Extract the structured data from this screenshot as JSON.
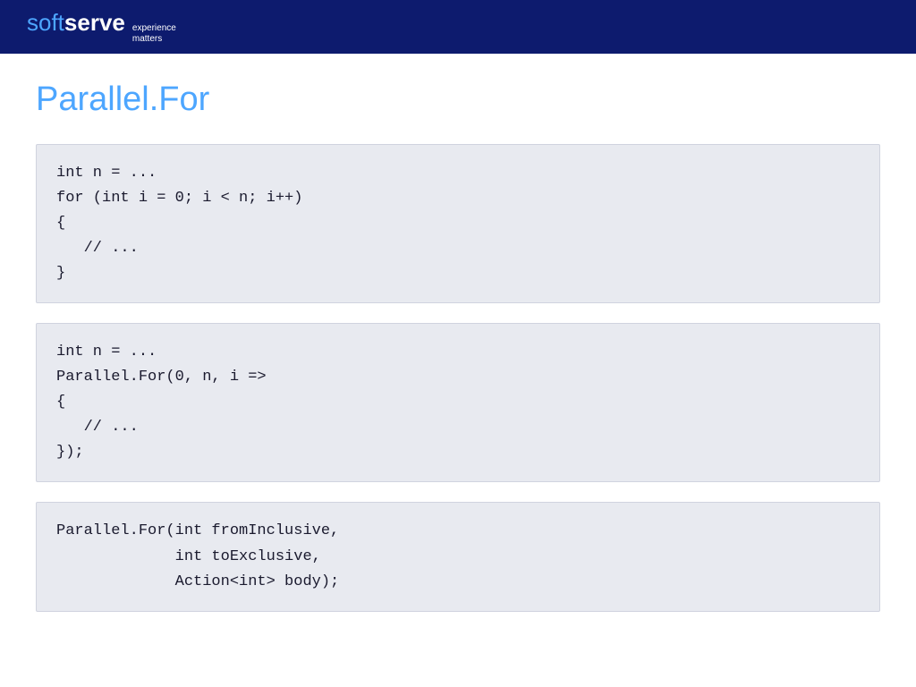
{
  "header": {
    "logo_soft": "soft",
    "logo_serve": "serve",
    "tagline_line1": "experience",
    "tagline_line2": "matters"
  },
  "page": {
    "title": "Parallel.For"
  },
  "code_blocks": [
    {
      "id": "block1",
      "code": "int n = ...\nfor (int i = 0; i < n; i++)\n{\n   // ...\n}"
    },
    {
      "id": "block2",
      "code": "int n = ...\nParallel.For(0, n, i =>\n{\n   // ...\n});"
    },
    {
      "id": "block3",
      "code": "Parallel.For(int fromInclusive,\n             int toExclusive,\n             Action<int> body);"
    }
  ]
}
